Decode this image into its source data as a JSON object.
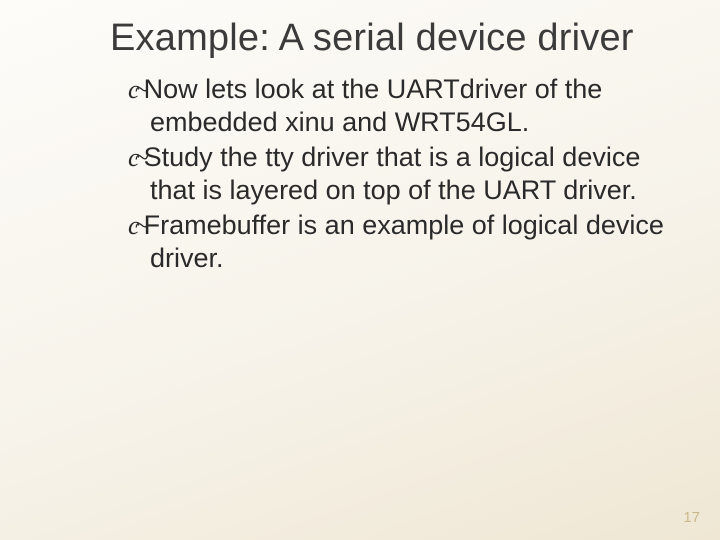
{
  "slide": {
    "title": "Example:  A serial device driver",
    "bullets": [
      "Now lets look at the UARTdriver of the embedded xinu and WRT54GL.",
      "Study the tty driver that is a logical device that is layered on top of the UART driver.",
      "Framebuffer is an example of logical device driver."
    ],
    "page_number": "17",
    "bullet_glyph": "c~"
  }
}
